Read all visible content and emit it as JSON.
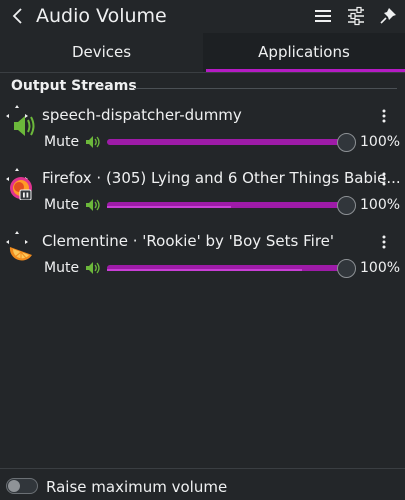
{
  "header": {
    "title": "Audio Volume",
    "icons": [
      "back-icon",
      "hamburger-menu-icon",
      "mixer-settings-icon",
      "pin-icon"
    ]
  },
  "tabs": [
    {
      "label": "Devices",
      "active": false
    },
    {
      "label": "Applications",
      "active": true
    }
  ],
  "section": {
    "title": "Output Streams"
  },
  "streams": [
    {
      "name": "speech-dispatcher-dummy",
      "mute_label": "Mute",
      "volume": "100%",
      "level": 1.0,
      "peak": 0,
      "icon": "speaker-icon"
    },
    {
      "name": "Firefox · (305) Lying and 6 Other Things Babie...",
      "mute_label": "Mute",
      "volume": "100%",
      "level": 1.0,
      "peak": 0.52,
      "icon": "firefox-icon"
    },
    {
      "name": "Clementine · 'Rookie' by 'Boy Sets Fire'",
      "mute_label": "Mute",
      "volume": "100%",
      "level": 1.0,
      "peak": 0.82,
      "icon": "clementine-icon"
    }
  ],
  "footer": {
    "toggle_label": "Raise maximum volume",
    "toggle_on": false
  },
  "colors": {
    "accent": "#9e1ba8",
    "tab_indicator": "#b51bc4",
    "speaker_green": "#6cb83b",
    "background": "#232629"
  }
}
